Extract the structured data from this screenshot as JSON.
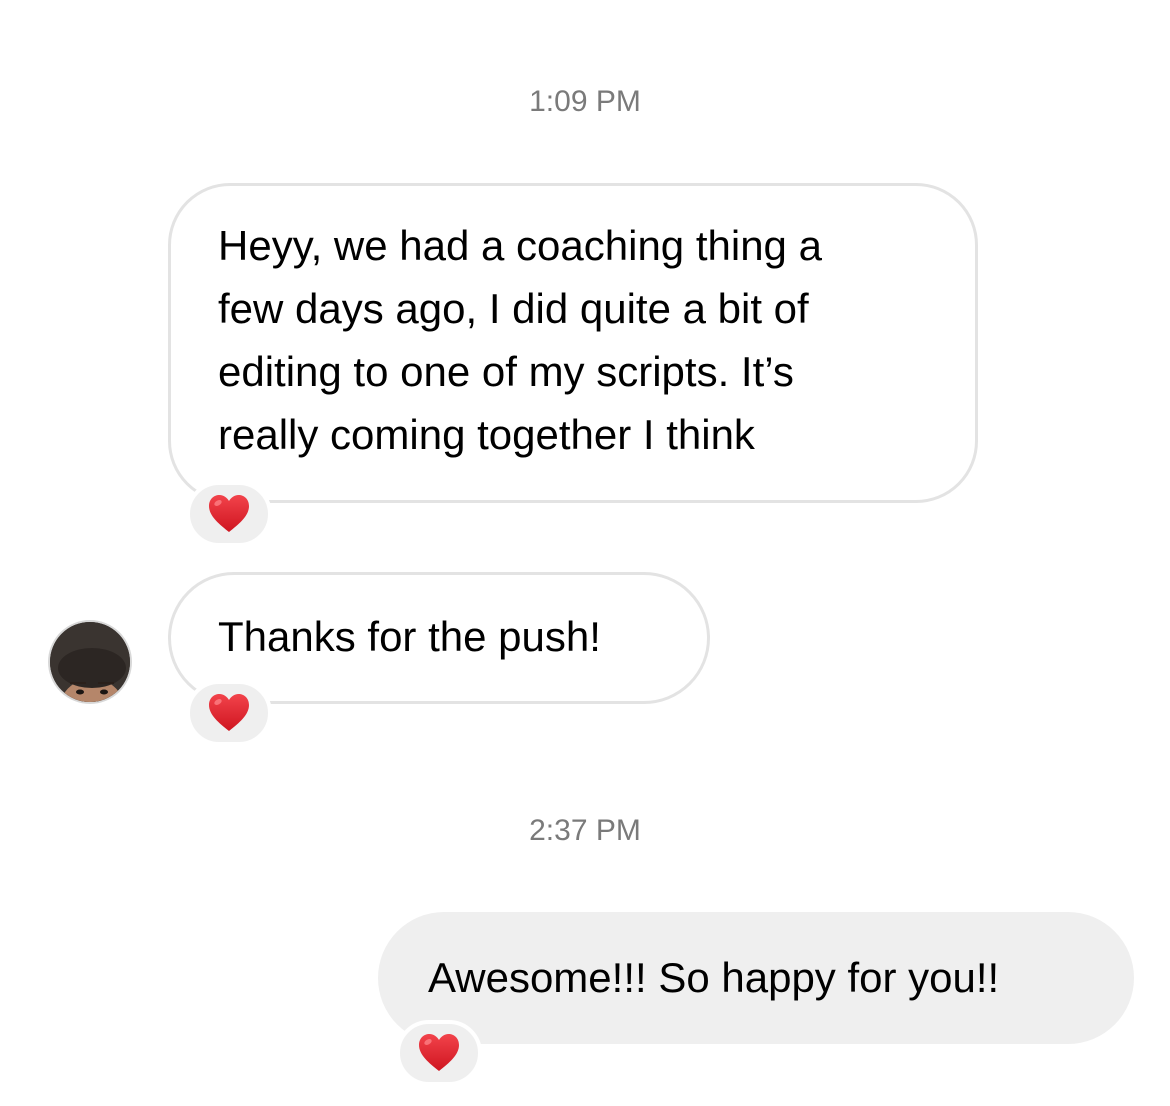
{
  "messages": [
    {
      "timestamp": "1:09 PM",
      "incoming": [
        {
          "text_lines": [
            "Heyy, we had a coaching thing a",
            "few days ago, I did quite a bit of",
            "editing to one of my scripts. It’s",
            "really coming together I think"
          ],
          "reaction": "heart-icon"
        },
        {
          "text_lines": [
            "Thanks for the push!"
          ],
          "reaction": "heart-icon"
        }
      ]
    },
    {
      "timestamp": "2:37 PM",
      "outgoing": [
        {
          "text_lines": [
            "Awesome!!! So happy for you!!"
          ],
          "reaction": "heart-icon"
        }
      ]
    }
  ],
  "colors": {
    "timestamp": "#7a7a7a",
    "incoming_border": "#e3e3e3",
    "outgoing_background": "#efefef",
    "reaction_heart": "#e0202a"
  }
}
